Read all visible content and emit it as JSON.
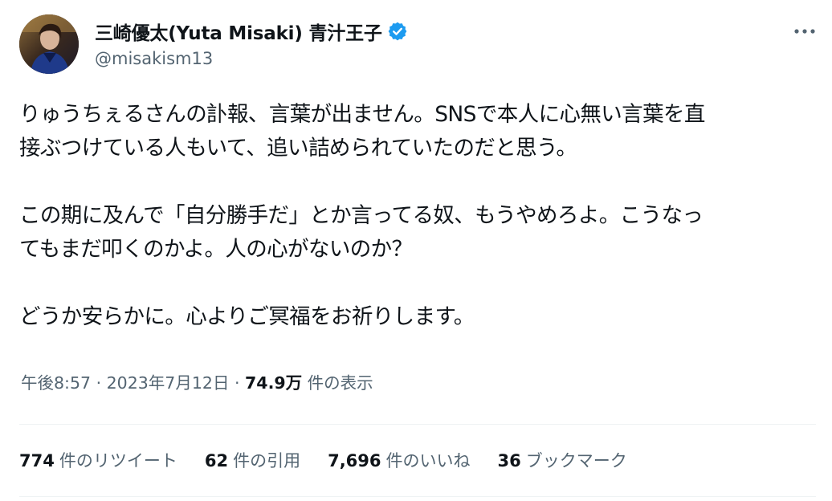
{
  "user": {
    "display_name": "三崎優太(Yuta Misaki) 青汁王子",
    "handle": "@misakism13",
    "verified": true
  },
  "tweet": {
    "paragraphs": [
      [
        "りゅうちぇるさんの訃報、言葉が出ません。SNSで本人に心無い言葉を直",
        "接ぶつけている人もいて、追い詰められていたのだと思う。"
      ],
      [
        "この期に及んで「自分勝手だ」とか言ってる奴、もうやめろよ。こうなっ",
        "てもまだ叩くのかよ。人の心がないのか？"
      ],
      [
        "どうか安らかに。心よりご冥福をお祈りします。"
      ]
    ]
  },
  "meta": {
    "time": "午後8:57",
    "separator": "·",
    "date": "2023年7月12日",
    "views_count": "74.9万",
    "views_label": "件の表示"
  },
  "stats": [
    {
      "count": "774",
      "label": "件のリツイート"
    },
    {
      "count": "62",
      "label": "件の引用"
    },
    {
      "count": "7,696",
      "label": "件のいいね"
    },
    {
      "count": "36",
      "label": "ブックマーク"
    }
  ],
  "colors": {
    "text": "#0f1419",
    "secondary": "#536471",
    "verified": "#1d9bf0",
    "divider": "#eff3f4"
  },
  "icons": {
    "verified": "verified-badge-icon",
    "more": "more-options-icon"
  }
}
